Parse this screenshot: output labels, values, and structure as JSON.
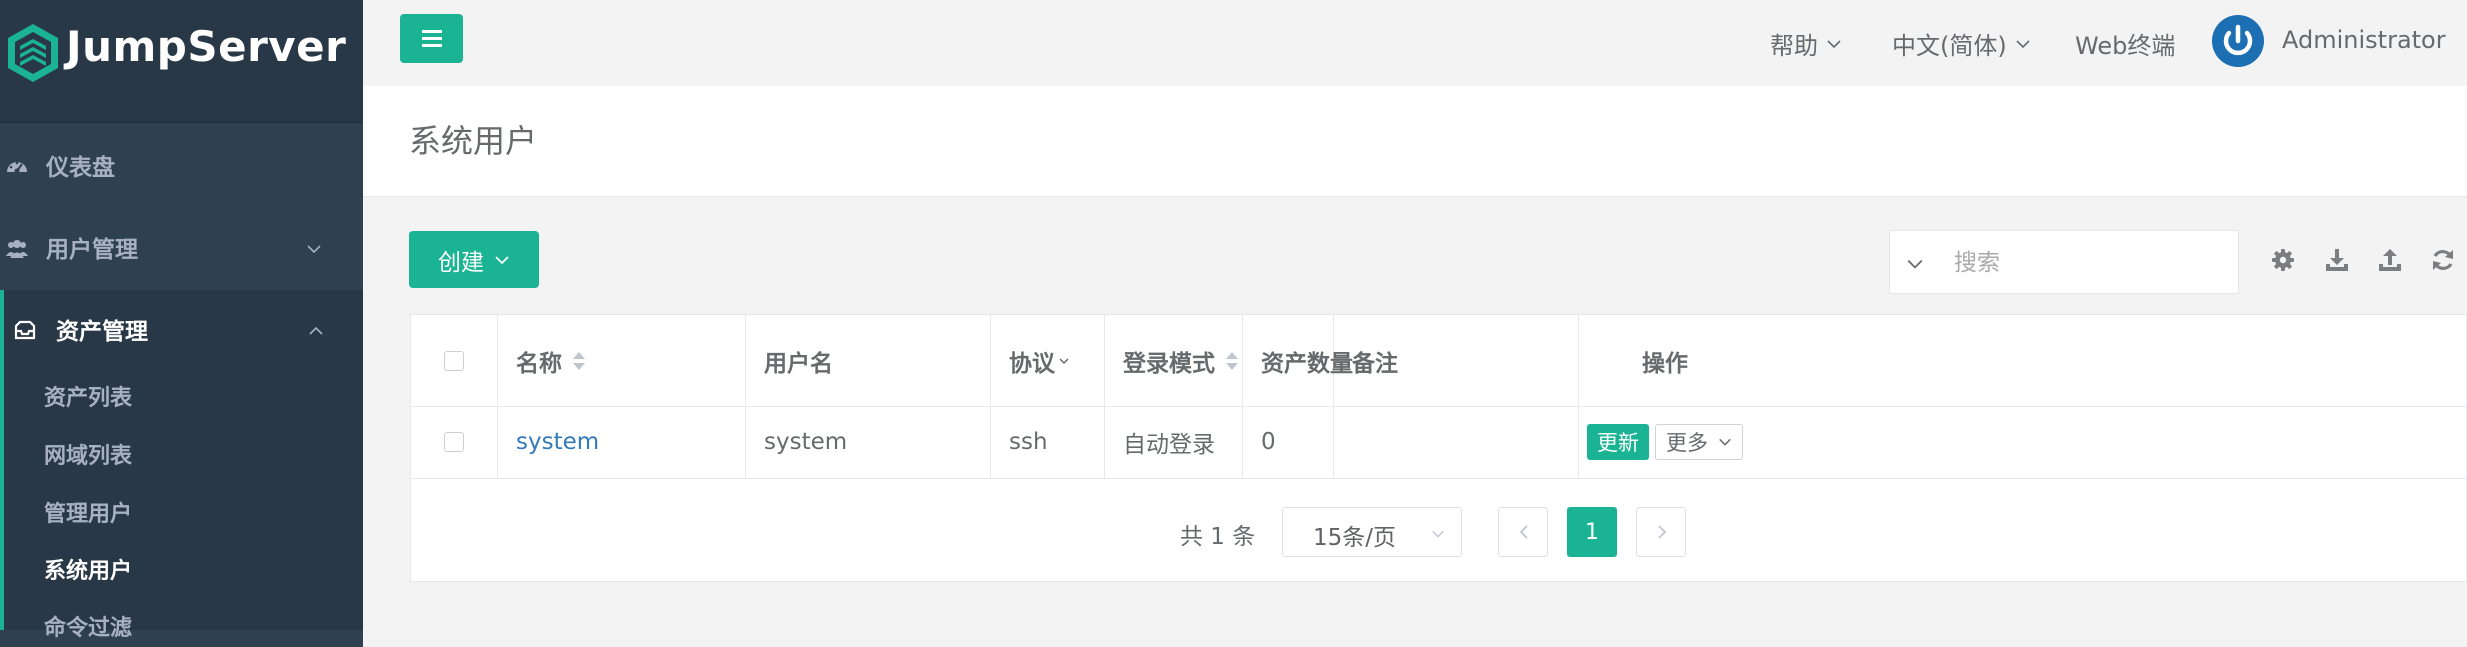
{
  "brand": {
    "name": "JumpServer"
  },
  "sidebar": {
    "items": [
      {
        "label": "仪表盘",
        "icon": "dashboard-icon"
      },
      {
        "label": "用户管理",
        "icon": "users-icon"
      },
      {
        "label": "资产管理",
        "icon": "inbox-icon",
        "expanded": true
      }
    ],
    "subitems": [
      {
        "label": "资产列表"
      },
      {
        "label": "网域列表"
      },
      {
        "label": "管理用户"
      },
      {
        "label": "系统用户",
        "current": true
      },
      {
        "label": "命令过滤"
      }
    ]
  },
  "topbar": {
    "help_label": "帮助",
    "language_label": "中文(简体)",
    "web_terminal_label": "Web终端",
    "user_name": "Administrator"
  },
  "page": {
    "title": "系统用户"
  },
  "toolbar": {
    "create_label": "创建",
    "search_placeholder": "搜索",
    "icons": [
      "settings-icon",
      "download-icon",
      "upload-icon",
      "refresh-icon"
    ]
  },
  "table": {
    "columns": [
      {
        "label": "名称",
        "sortable": true
      },
      {
        "label": "用户名"
      },
      {
        "label": "协议",
        "filterable": true
      },
      {
        "label": "登录模式",
        "sortable": true
      },
      {
        "label": "资产数量"
      },
      {
        "label": "备注"
      },
      {
        "label": "操作"
      }
    ],
    "rows": [
      {
        "name": "system",
        "username": "system",
        "protocol": "ssh",
        "login_mode": "自动登录",
        "asset_count": "0",
        "comment": "",
        "update_label": "更新",
        "more_label": "更多"
      }
    ]
  },
  "pagination": {
    "total_text": "共 1 条",
    "page_size": "15条/页",
    "current_page": "1"
  },
  "colors": {
    "accent": "#1ab394",
    "sidebar_bg": "#2f4050",
    "sidebar_header_bg": "#293846",
    "link": "#337ab7",
    "avatar": "#1d6fb3"
  }
}
